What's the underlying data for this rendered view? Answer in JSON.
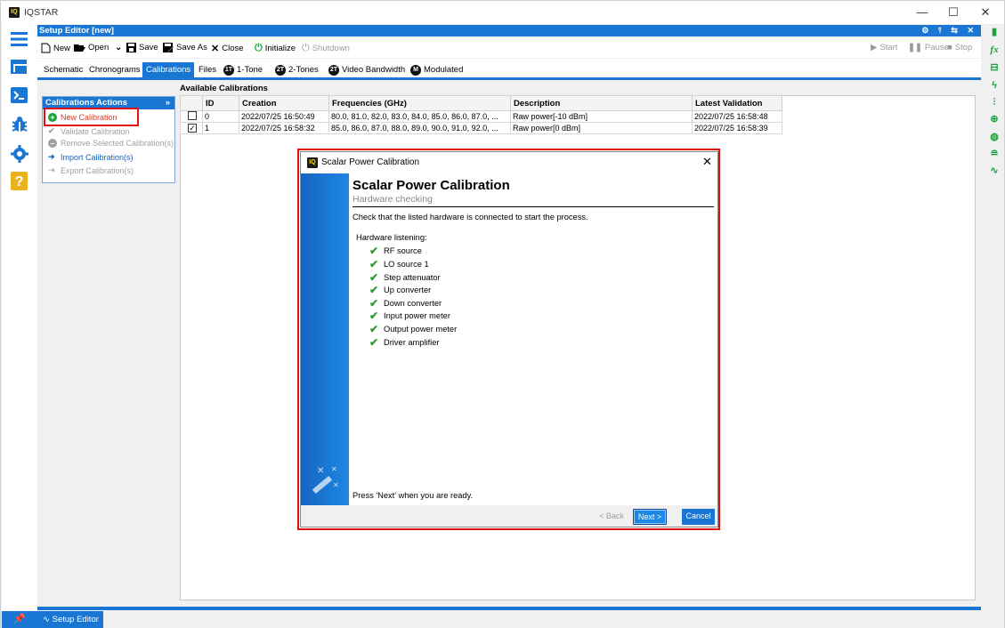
{
  "app": {
    "title": "IQSTAR",
    "logo_text": "IQ",
    "window_controls": {
      "minimize": "—",
      "maximize": "☐",
      "close": "✕"
    }
  },
  "panel": {
    "title": "Setup Editor [new]"
  },
  "toolbar": {
    "new": "New",
    "open": "Open",
    "save": "Save",
    "save_as": "Save As",
    "close": "Close",
    "initialize": "Initialize",
    "shutdown": "Shutdown",
    "start": "Start",
    "pause": "Pause",
    "stop": "Stop"
  },
  "tabs": [
    {
      "label": "Schematic",
      "badge": ""
    },
    {
      "label": "Chronograms",
      "badge": ""
    },
    {
      "label": "Calibrations",
      "badge": "",
      "active": true
    },
    {
      "label": "Files",
      "badge": ""
    },
    {
      "label": "1-Tone",
      "badge": "1T"
    },
    {
      "label": "2-Tones",
      "badge": "2T"
    },
    {
      "label": "Video Bandwidth",
      "badge": "2T"
    },
    {
      "label": "Modulated",
      "badge": "M"
    }
  ],
  "actions": {
    "title": "Calibrations Actions",
    "items": [
      {
        "label": "New Calibration",
        "enabled": true,
        "color": "#e03a1e"
      },
      {
        "label": "Validate Calibration",
        "enabled": false
      },
      {
        "label": "Remove Selected Calibration(s)",
        "enabled": false
      },
      {
        "label": "Import Calibration(s)",
        "enabled": true,
        "color": "#1565c0"
      },
      {
        "label": "Export Calibration(s)",
        "enabled": false
      }
    ]
  },
  "calibrations": {
    "title": "Available Calibrations",
    "columns": [
      "ID",
      "Creation",
      "Frequencies (GHz)",
      "Description",
      "Latest Validation"
    ],
    "rows": [
      {
        "checked": false,
        "id": "0",
        "creation": "2022/07/25 16:50:49",
        "frequencies": "80.0, 81.0, 82.0, 83.0, 84.0, 85.0, 86.0, 87.0, ...",
        "description": "Raw power[-10 dBm]",
        "latest": "2022/07/25 16:58:48"
      },
      {
        "checked": true,
        "id": "1",
        "creation": "2022/07/25 16:58:32",
        "frequencies": "85.0, 86.0, 87.0, 88.0, 89.0, 90.0, 91.0, 92.0, ...",
        "description": "Raw power[0 dBm]",
        "latest": "2022/07/25 16:58:39"
      }
    ]
  },
  "dialog": {
    "window_title": "Scalar Power Calibration",
    "heading": "Scalar Power Calibration",
    "subheading": "Hardware checking",
    "instruction": "Check that the listed hardware is connected to start the process.",
    "hardware_label": "Hardware listening:",
    "hardware": [
      "RF source",
      "LO source 1",
      "Step attenuator",
      "Up converter",
      "Down converter",
      "Input power meter",
      "Output power meter",
      "Driver amplifier"
    ],
    "footer_note": "Press 'Next' when you are ready.",
    "back": "< Back",
    "next": "Next >",
    "cancel": "Cancel"
  },
  "status_tab": {
    "label": "Setup Editor"
  },
  "colors": {
    "accent": "#1976d2",
    "highlight": "#e01010",
    "ok": "#2e9e2e"
  }
}
